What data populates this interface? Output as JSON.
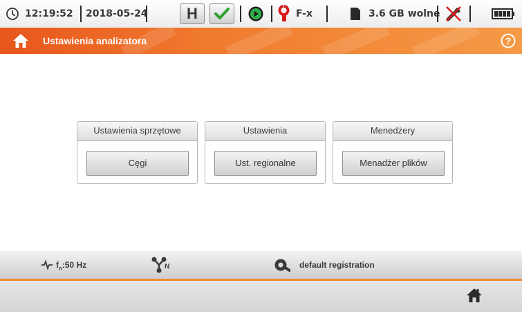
{
  "status": {
    "time": "12:19:52",
    "date": "2018-05-24",
    "clamp_type": "F-x",
    "memory": "3.6 GB wolne",
    "hold_label": "H"
  },
  "title": {
    "text": "Ustawienia analizatora"
  },
  "groups": [
    {
      "header": "Ustawienia sprzętowe",
      "button": "Cęgi"
    },
    {
      "header": "Ustawienia",
      "button": "Ust. regionalne"
    },
    {
      "header": "Menedżery",
      "button": "Menadżer plików"
    }
  ],
  "infobar": {
    "frequency_label": "f",
    "frequency_sub": "n",
    "frequency_value": ":50 Hz",
    "network_sub": "N",
    "registration": "default registration"
  },
  "colors": {
    "accent": "#f07a2e",
    "ok": "#2fa12f"
  }
}
